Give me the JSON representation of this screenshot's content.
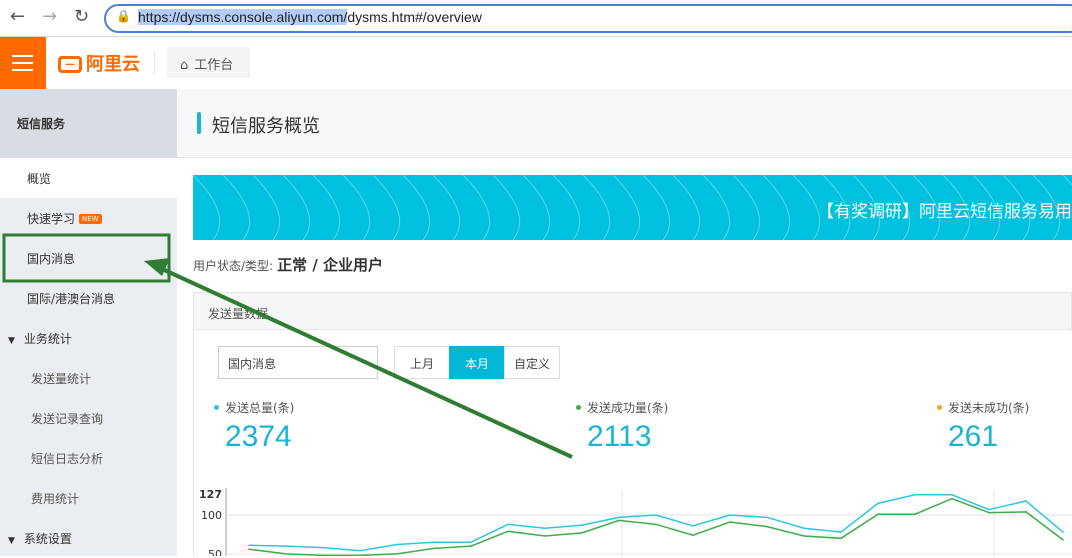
{
  "browser": {
    "url_selected": "https://dysms.console.aliyun.com/",
    "url_rest": "dysms.htm#/overview",
    "back_icon": "arrow-left",
    "forward_icon": "arrow-right",
    "reload_icon": "reload",
    "lock_icon": "lock"
  },
  "topbar": {
    "logo": "阿里云",
    "workbench": "工作台"
  },
  "sidebar": {
    "title": "短信服务",
    "items": [
      {
        "label": "概览",
        "active": true
      },
      {
        "label": "快速学习",
        "badge": "NEW"
      },
      {
        "label": "国内消息"
      },
      {
        "label": "国际/港澳台消息"
      },
      {
        "label": "业务统计",
        "group": true
      },
      {
        "label": "发送量统计",
        "sub": true
      },
      {
        "label": "发送记录查询",
        "sub": true
      },
      {
        "label": "短信日志分析",
        "sub": true
      },
      {
        "label": "费用统计",
        "sub": true
      },
      {
        "label": "系统设置",
        "group": true
      }
    ]
  },
  "page": {
    "title": "短信服务概览",
    "banner": "【有奖调研】阿里云短信服务易用",
    "user_status_label": "用户状态/类型:",
    "user_status_value": "正常 / 企业用户"
  },
  "panel": {
    "title": "发送量数据",
    "select_value": "国内消息",
    "ranges": [
      "上月",
      "本月",
      "自定义"
    ],
    "active_range": "本月"
  },
  "stats": [
    {
      "label": "发送总量(条)",
      "value": "2374",
      "color": "#2ec5e0"
    },
    {
      "label": "发送成功量(条)",
      "value": "2113",
      "color": "#3cae4a"
    },
    {
      "label": "发送未成功(条)",
      "value": "261",
      "color": "#f5a623"
    }
  ],
  "colors": {
    "accent": "#00c1de",
    "brand": "#ff6a00",
    "annotation": "#2e7d32"
  },
  "chart_data": {
    "type": "line",
    "y_ticks": [
      "127",
      "100",
      "50"
    ],
    "ylim_visible": [
      48,
      127
    ],
    "grid": true,
    "series": [
      {
        "color": "#2ec5e0",
        "values": [
          61,
          60,
          58,
          54,
          62,
          65,
          65,
          88,
          83,
          87,
          97,
          100,
          86,
          100,
          97,
          83,
          78,
          115,
          126,
          126,
          107,
          118,
          78
        ]
      },
      {
        "color": "#3cae4a",
        "values": [
          56,
          50,
          48,
          48,
          50,
          57,
          60,
          79,
          73,
          77,
          93,
          88,
          74,
          91,
          85,
          73,
          70,
          101,
          101,
          121,
          103,
          104,
          68
        ]
      }
    ]
  }
}
